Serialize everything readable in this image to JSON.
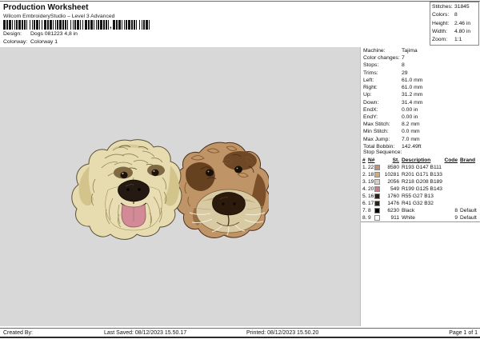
{
  "header": {
    "title": "Production Worksheet",
    "subtitle": "Wilcom EmbroideryStudio – Level 3 Advanced",
    "design_label": "Design:",
    "design_value": "Dogs 081223 4,8 in",
    "colorway_label": "Colorway:",
    "colorway_value": "Colorway 1"
  },
  "stats": {
    "rows": [
      {
        "label": "Stitches:",
        "value": "31845"
      },
      {
        "label": "Colors:",
        "value": "8"
      },
      {
        "label": "Height:",
        "value": "2.46 in"
      },
      {
        "label": "Width:",
        "value": "4.80 in"
      },
      {
        "label": "Zoom:",
        "value": "1:1"
      }
    ]
  },
  "machine": {
    "rows": [
      {
        "label": "Machine:",
        "value": "Tajima"
      },
      {
        "label": "Color changes:",
        "value": "7"
      },
      {
        "label": "Stops:",
        "value": "8"
      },
      {
        "label": "Trims:",
        "value": "29"
      },
      {
        "label": "Left:",
        "value": "61.0 mm"
      },
      {
        "label": "Right:",
        "value": "61.0 mm"
      },
      {
        "label": "Up:",
        "value": "31.2 mm"
      },
      {
        "label": "Down:",
        "value": "31.4 mm"
      },
      {
        "label": "EndX:",
        "value": "0.00 in"
      },
      {
        "label": "EndY:",
        "value": "0.00 in"
      },
      {
        "label": "Max Stitch:",
        "value": "8.2 mm"
      },
      {
        "label": "Min Stitch:",
        "value": "0.0 mm"
      },
      {
        "label": "Max Jump:",
        "value": "7.0 mm"
      },
      {
        "label": "Total Bobbin:",
        "value": "142.49ft"
      }
    ]
  },
  "stop_sequence": {
    "title": "Stop Sequence:",
    "columns": [
      "#",
      "N#",
      "St.",
      "Description",
      "Code",
      "Brand"
    ],
    "rows": [
      {
        "idx": "1.",
        "n": "22",
        "color": "#C1936F",
        "st": "8580",
        "description": "R193 G147 B111",
        "code": "",
        "brand": ""
      },
      {
        "idx": "2.",
        "n": "18",
        "color": "#C9AB85",
        "st": "10281",
        "description": "R201 G171 B133",
        "code": "",
        "brand": ""
      },
      {
        "idx": "3.",
        "n": "19",
        "color": "#DAD0BD",
        "st": "2056",
        "description": "R218 G208 B189",
        "code": "",
        "brand": ""
      },
      {
        "idx": "4.",
        "n": "20",
        "color": "#C77D8F",
        "st": "549",
        "description": "R199 G125 B143",
        "code": "",
        "brand": ""
      },
      {
        "idx": "5.",
        "n": "16",
        "color": "#371B0D",
        "st": "1760",
        "description": "R55 G27 B13",
        "code": "",
        "brand": ""
      },
      {
        "idx": "6.",
        "n": "17",
        "color": "#292020",
        "st": "1476",
        "description": "R41 G32 B32",
        "code": "",
        "brand": ""
      },
      {
        "idx": "7.",
        "n": "8",
        "color": "#000000",
        "st": "6230",
        "description": "Black",
        "code": "8",
        "brand": "Default"
      },
      {
        "idx": "8.",
        "n": "9",
        "color": "#FFFFFF",
        "st": "911",
        "description": "White",
        "code": "9",
        "brand": "Default"
      }
    ]
  },
  "design_preview": {
    "background": "#d8d8d8",
    "description": "Embroidered heads of two shaggy dogs, cream dog with pink tongue and tan curly dog"
  },
  "footer": {
    "created_by_label": "Created By:",
    "last_saved": "Last Saved: 08/12/2023 15.50.17",
    "printed": "Printed: 08/12/2023 15.50.20",
    "page": "Page 1 of 1"
  }
}
